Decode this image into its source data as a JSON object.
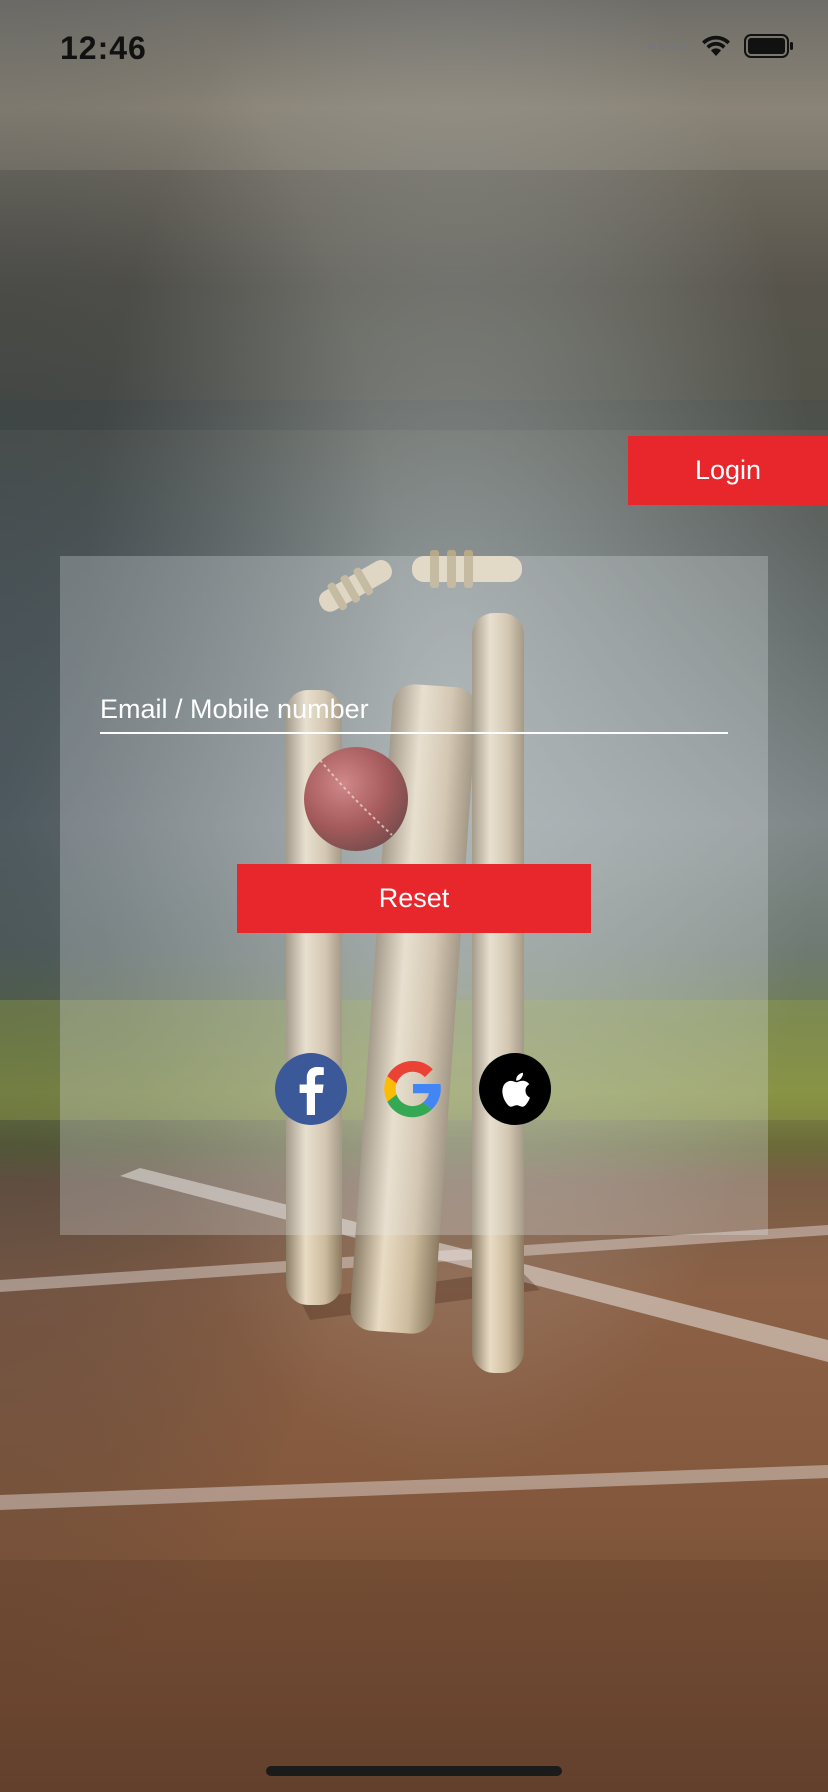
{
  "status_bar": {
    "time": "12:46"
  },
  "header": {
    "login_label": "Login"
  },
  "form": {
    "email_placeholder": "Email / Mobile number",
    "email_value": "",
    "reset_label": "Reset"
  },
  "social_logins": [
    {
      "name": "facebook-icon",
      "color": "#3b5998"
    },
    {
      "name": "google-icon",
      "color": "#4285f4"
    },
    {
      "name": "apple-icon",
      "color": "#000000"
    }
  ],
  "colors": {
    "accent": "#e8272d",
    "field_underline": "#ffffff"
  }
}
